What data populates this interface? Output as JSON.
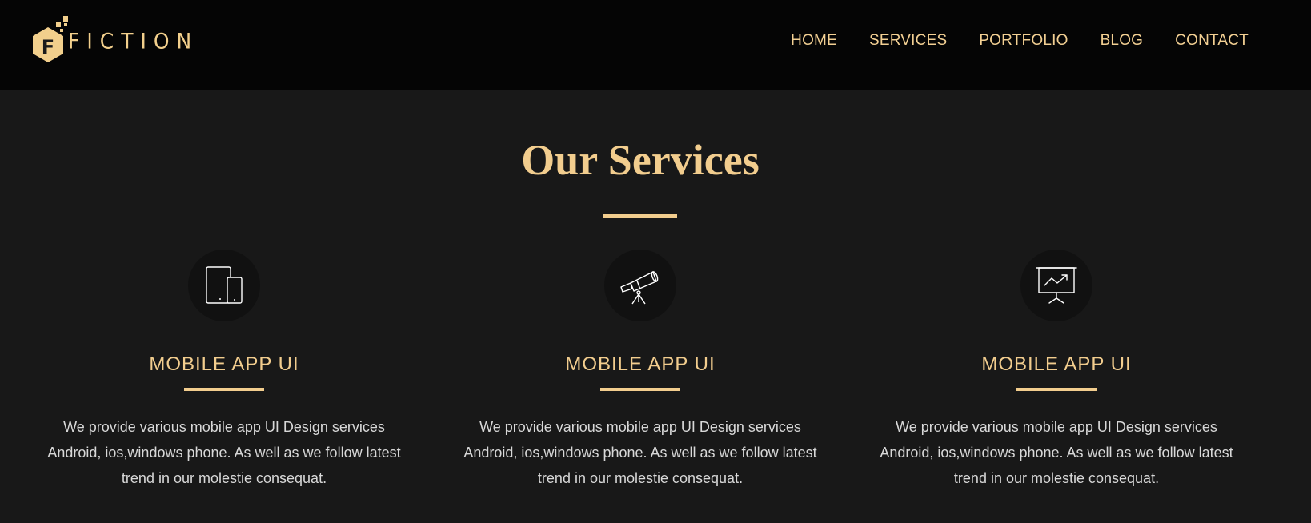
{
  "header": {
    "logo": {
      "mark_letter": "F",
      "wordmark": "FICTION"
    },
    "nav": [
      {
        "label": "HOME"
      },
      {
        "label": "SERVICES"
      },
      {
        "label": "PORTFOLIO"
      },
      {
        "label": "BLOG"
      },
      {
        "label": "CONTACT"
      }
    ]
  },
  "main": {
    "title": "Our Services",
    "services": [
      {
        "icon": "tablet-phone-icon",
        "title": "MOBILE APP UI",
        "description": "We provide various mobile app UI Design services Android, ios,windows phone. As well as we follow latest trend in our molestie consequat."
      },
      {
        "icon": "telescope-icon",
        "title": "MOBILE APP UI",
        "description": "We provide various mobile app UI Design services Android, ios,windows phone. As well as we follow latest trend in our molestie consequat."
      },
      {
        "icon": "presentation-chart-icon",
        "title": "MOBILE APP UI",
        "description": "We provide various mobile app UI Design services Android, ios,windows phone. As well as we follow latest trend in our molestie consequat."
      }
    ]
  },
  "colors": {
    "accent": "#f2cd8e",
    "header_bg": "#050505",
    "page_bg": "#181818",
    "icon_circle_bg": "#111111",
    "body_text": "#d8d8d8"
  }
}
